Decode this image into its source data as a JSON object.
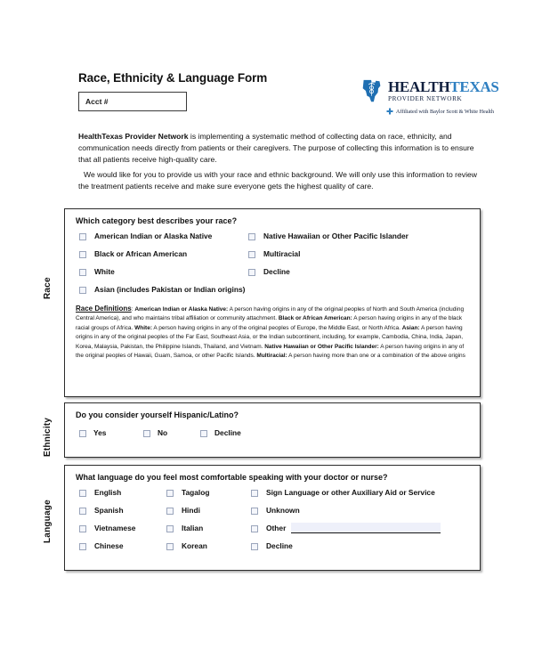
{
  "header": {
    "form_title": "Race, Ethnicity & Language Form",
    "acct_value": "Acct #",
    "acct_placeholder": "Acct #"
  },
  "logo": {
    "word_1": "HEALTH",
    "word_2": "TEXAS",
    "subtitle": "PROVIDER NETWORK",
    "affiliation": "Affiliated with Baylor Scott & White Health",
    "mark_name": "texas-caduceus-icon",
    "color_dark": "#11203f",
    "color_blue": "#2e7fc1"
  },
  "intro": {
    "paragraph_1_bold": "HealthTexas Provider Network",
    "paragraph_1_rest": " is implementing a systematic method of collecting data on race, ethnicity, and communication needs directly from patients or their caregivers. The purpose of collecting this information is to ensure that all patients receive high-quality care.",
    "paragraph_2": "We would like for you to provide us with your race and ethnic background. We will only use this information to review the treatment patients receive and make sure everyone gets the highest quality of care."
  },
  "race": {
    "side_label": "Race",
    "question": "Which category best describes your race?",
    "options_left": [
      "American Indian or Alaska Native",
      "Black or African American",
      "White",
      "Asian (includes Pakistan or Indian origins)"
    ],
    "options_right": [
      "Native Hawaiian or Other Pacific Islander",
      "Multiracial",
      "Decline"
    ],
    "definitions_title": "Race Definitions",
    "definitions": [
      {
        "term": "American Indian or Alaska Native",
        "text": "A person having origins in any of the original peoples of North and South America (including Central America), and who maintains tribal affiliation or community attachment."
      },
      {
        "term": "Black or African American",
        "text": "A person having origins in any of the black racial groups of Africa."
      },
      {
        "term": "White",
        "text": "A person having origins in any of the original peoples of Europe, the Middle East, or North Africa."
      },
      {
        "term": "Asian",
        "text": "A person having origins in any of the original peoples of the Far East, Southeast Asia, or the Indian subcontinent, including, for example, Cambodia, China, India, Japan, Korea, Malaysia, Pakistan, the Philippine Islands, Thailand, and Vietnam."
      },
      {
        "term": "Native Hawaiian or Other Pacific Islander",
        "text": "A person having origins in any of the original peoples of Hawaii, Guam, Samoa, or other Pacific Islands."
      },
      {
        "term": "Multiracial",
        "text": "A person having more than one or a combination of the above origins"
      }
    ]
  },
  "ethnicity": {
    "side_label": "Ethnicity",
    "question": "Do you consider yourself Hispanic/Latino?",
    "options": [
      "Yes",
      "No",
      "Decline"
    ]
  },
  "language": {
    "side_label": "Language",
    "question": "What language do you feel most comfortable speaking with your doctor or nurse?",
    "options_col1": [
      "English",
      "Spanish",
      "Vietnamese",
      "Chinese"
    ],
    "options_col2": [
      "Tagalog",
      "Hindi",
      "Italian",
      "Korean"
    ],
    "options_col3": [
      "Sign Language or other Auxiliary Aid or Service",
      "Unknown",
      "Other",
      "Decline"
    ],
    "other_label": "Other",
    "other_value": "",
    "other_placeholder": ""
  },
  "colors": {
    "checkbox_border": "#9aa5bb",
    "checkbox_fill": "#f4f6fb",
    "section_border": "#2c2c2c",
    "other_field_fill": "#eef0fa"
  }
}
